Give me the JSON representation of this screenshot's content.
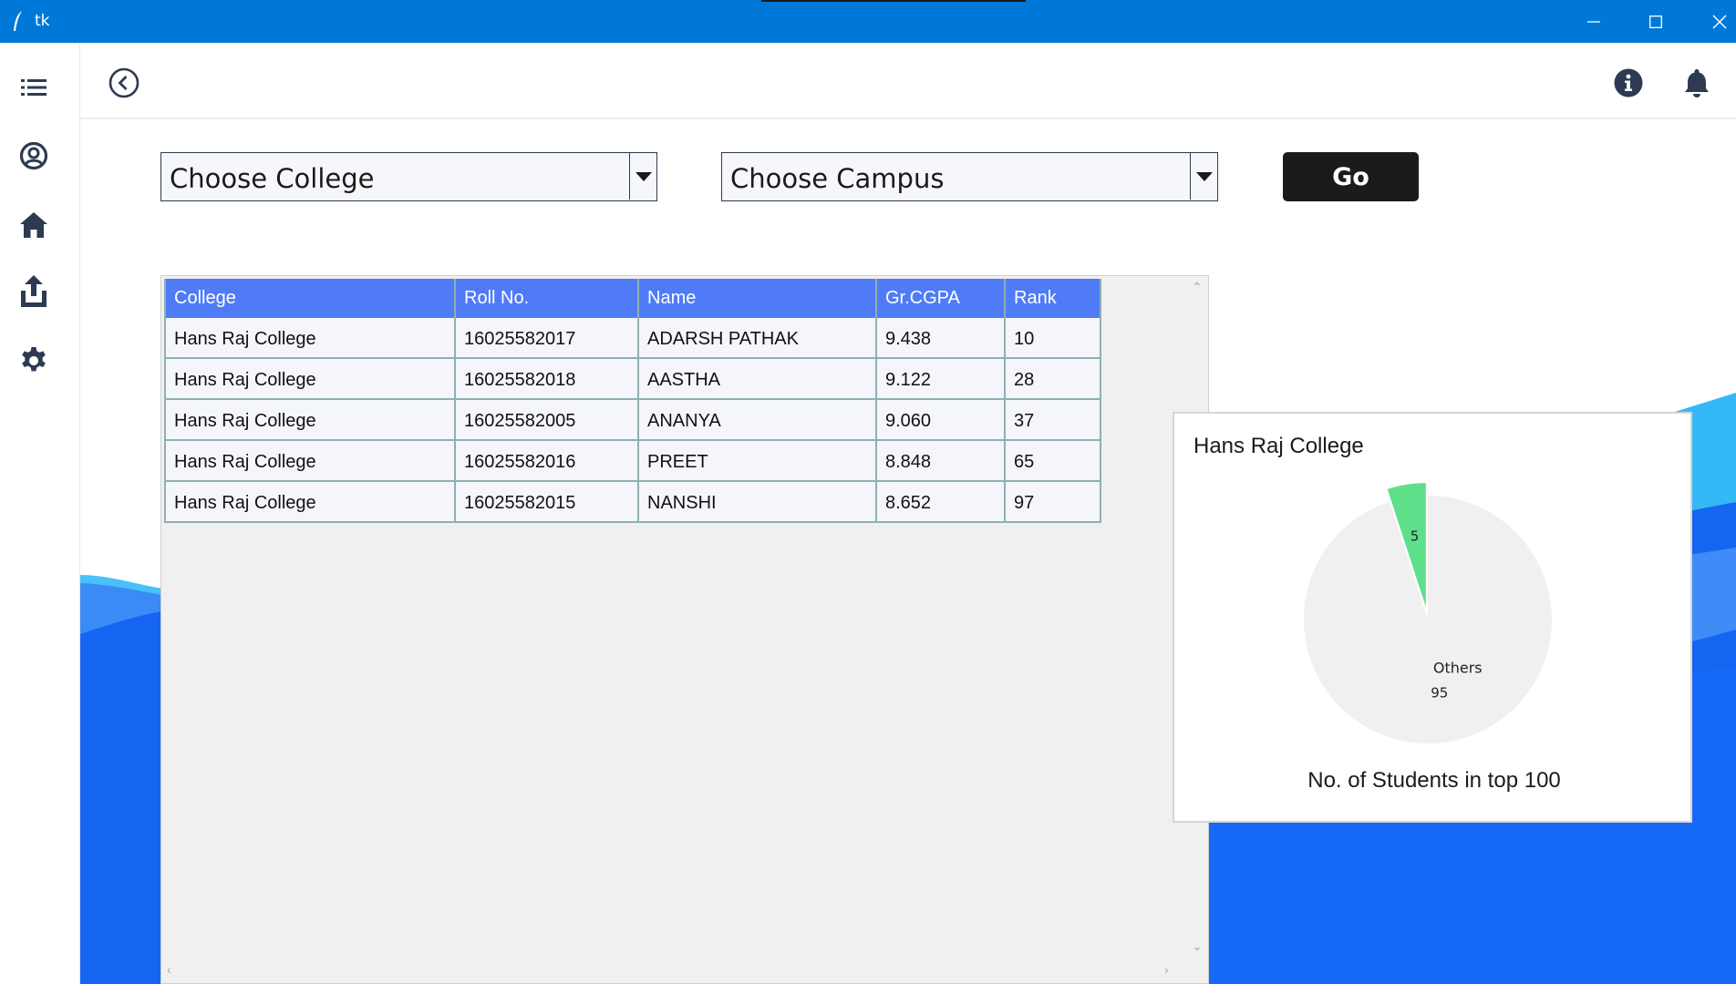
{
  "window": {
    "title": "tk"
  },
  "header": {
    "back_icon": "back-circle-icon",
    "info_icon": "info-icon",
    "bell_icon": "bell-icon"
  },
  "sidebar": {
    "items": [
      {
        "icon": "list-icon"
      },
      {
        "icon": "user-circle-icon"
      },
      {
        "icon": "home-icon"
      },
      {
        "icon": "upload-icon"
      },
      {
        "icon": "gear-icon"
      }
    ]
  },
  "filters": {
    "college": {
      "value": "Choose College"
    },
    "campus": {
      "value": "Choose Campus"
    },
    "go_label": "Go"
  },
  "table": {
    "columns": [
      "College",
      "Roll No.",
      "Name",
      "Gr.CGPA",
      "Rank"
    ],
    "rows": [
      [
        "Hans Raj College",
        "16025582017",
        "ADARSH PATHAK",
        "9.438",
        "10"
      ],
      [
        "Hans Raj College",
        "16025582018",
        "AASTHA",
        "9.122",
        "28"
      ],
      [
        "Hans Raj College",
        "16025582005",
        "ANANYA",
        "9.060",
        "37"
      ],
      [
        "Hans Raj College",
        "16025582016",
        "PREET",
        "8.848",
        "65"
      ],
      [
        "Hans Raj College",
        "16025582015",
        "NANSHI",
        "8.652",
        "97"
      ]
    ]
  },
  "chart_data": {
    "type": "pie",
    "title": "Hans Raj College",
    "xlabel": "No. of Students in top 100",
    "slices": [
      {
        "label": "",
        "value": 5,
        "color": "#5ee08a",
        "exploded": true
      },
      {
        "label": "Others",
        "value": 95,
        "color": "#f0f0f0",
        "exploded": false
      }
    ]
  },
  "colors": {
    "titlebar": "#0078d7",
    "table_header": "#4f7bf7",
    "go_button": "#1b1b1b",
    "sidebar_icon": "#2d3a52"
  }
}
